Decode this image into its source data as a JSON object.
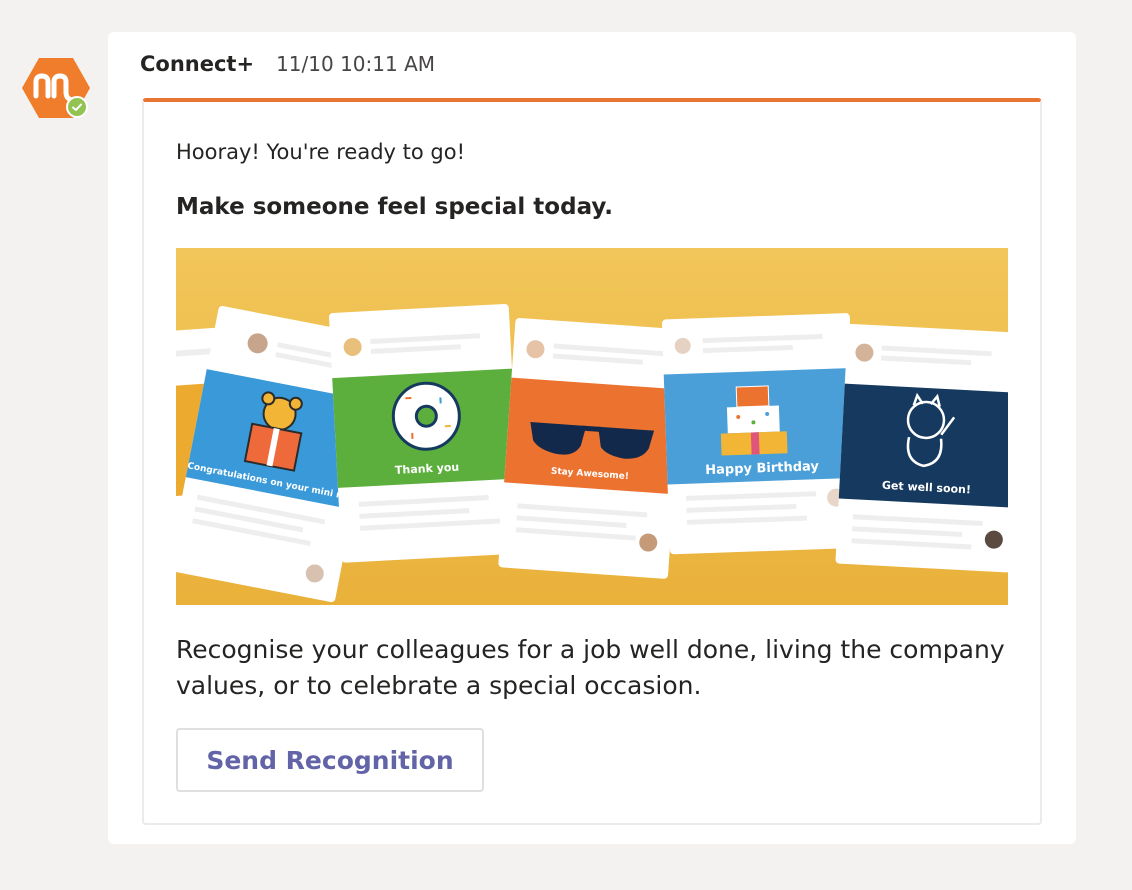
{
  "app": {
    "sender": "Connect+",
    "timestamp": "11/10 10:11 AM",
    "accent_color": "#e97533",
    "brand_color": "#e97533",
    "status_color": "#92c353"
  },
  "avatar": {
    "icon": "connect-plus-logo-icon",
    "status": "available"
  },
  "card": {
    "intro": "Hooray! You're ready to go!",
    "headline": "Make someone feel special today.",
    "body": "Recognise your colleagues for a job well done, living the company values, or to celebrate a special occasion.",
    "button_label": "Send Recognition",
    "hero": {
      "background_color": "#f2c14e",
      "cards": [
        {
          "caption": "Congratulations on your mini me!",
          "icon": "teddy-bear-icon",
          "color": "#3a9ad9"
        },
        {
          "caption": "Thank you",
          "icon": "donut-icon",
          "color": "#5daf3d"
        },
        {
          "caption": "Stay Awesome!",
          "icon": "sunglasses-icon",
          "color": "#ec7230"
        },
        {
          "caption": "Happy Birthday",
          "icon": "birthday-cake-icon",
          "color": "#4a9fd8"
        },
        {
          "caption": "Get well soon!",
          "icon": "lucky-cat-icon",
          "color": "#163a5f"
        }
      ]
    }
  }
}
